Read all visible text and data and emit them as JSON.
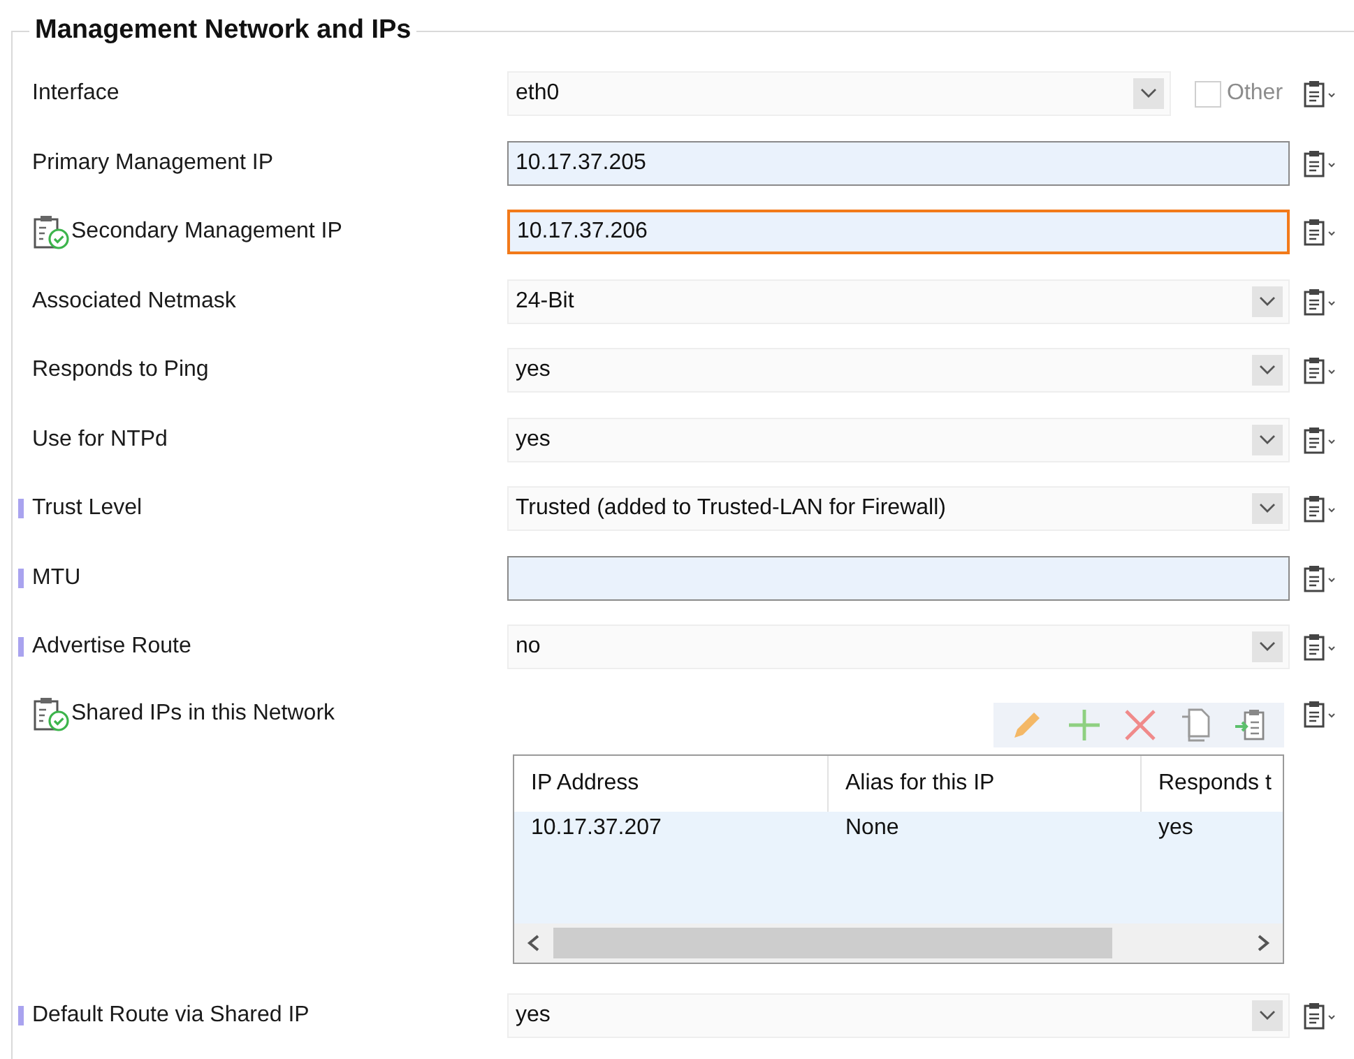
{
  "group": {
    "title": "Management Network and IPs"
  },
  "fields": [
    {
      "kind": "select",
      "label": "Interface",
      "value": "eth0",
      "marker": false,
      "validated": false,
      "focused": false,
      "other": {
        "label": "Other",
        "checked": false,
        "disabled": true
      }
    },
    {
      "kind": "input",
      "label": "Primary Management IP",
      "value": "10.17.37.205",
      "marker": false,
      "validated": false,
      "focused": false
    },
    {
      "kind": "input",
      "label": "Secondary Management IP",
      "value": "10.17.37.206",
      "marker": false,
      "validated": true,
      "focused": true
    },
    {
      "kind": "select",
      "label": "Associated Netmask",
      "value": "24-Bit",
      "marker": false,
      "validated": false,
      "focused": false
    },
    {
      "kind": "select",
      "label": "Responds to Ping",
      "value": "yes",
      "marker": false,
      "validated": false,
      "focused": false
    },
    {
      "kind": "select",
      "label": "Use for NTPd",
      "value": "yes",
      "marker": false,
      "validated": false,
      "focused": false
    },
    {
      "kind": "select",
      "label": "Trust Level",
      "value": "Trusted (added to Trusted-LAN for Firewall)",
      "marker": true,
      "validated": false,
      "focused": false
    },
    {
      "kind": "input",
      "label": "MTU",
      "marker": true,
      "validated": false,
      "focused": false
    },
    {
      "kind": "select",
      "label": "Advertise Route",
      "value": "no",
      "marker": true,
      "validated": false,
      "focused": false
    },
    {
      "kind": "table",
      "label": "Shared IPs in this Network",
      "marker": false,
      "validated": true,
      "columns": [
        "IP Address",
        "Alias for this IP",
        "Responds t"
      ],
      "rows": [
        [
          "10.17.37.207",
          "None",
          "yes"
        ]
      ]
    },
    {
      "kind": "select",
      "label": "Default Route via Shared IP",
      "value": "yes",
      "marker": true,
      "validated": false,
      "focused": false
    }
  ]
}
